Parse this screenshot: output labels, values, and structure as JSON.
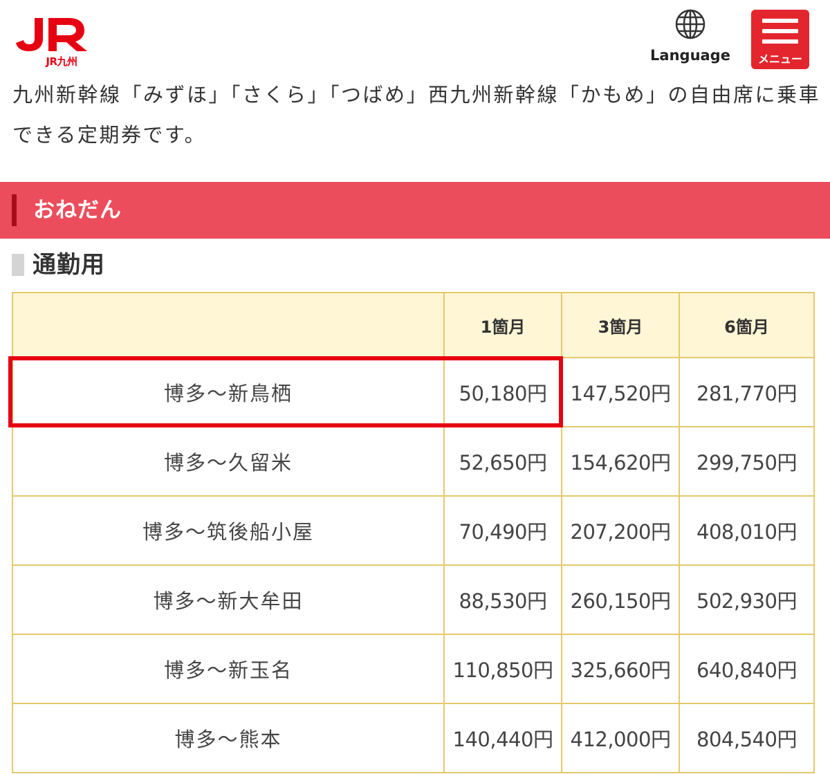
{
  "header": {
    "logo_text": "JR九州",
    "language_label": "Language",
    "language_icon": "globe-icon",
    "menu_label": "メニュー",
    "menu_icon": "hamburger-icon"
  },
  "intro_text": "九州新幹線「みずほ」「さくら」「つばめ」西九州新幹線「かもめ」の自由席に乗車できる定期券です。",
  "section": {
    "title": "おねだん"
  },
  "subsection": {
    "title": "通勤用"
  },
  "fare_table": {
    "headers": [
      "",
      "1箇月",
      "3箇月",
      "6箇月"
    ],
    "rows": [
      {
        "route": "博多～新鳥栖",
        "m1": "50,180円",
        "m3": "147,520円",
        "m6": "281,770円"
      },
      {
        "route": "博多～久留米",
        "m1": "52,650円",
        "m3": "154,620円",
        "m6": "299,750円"
      },
      {
        "route": "博多～筑後船小屋",
        "m1": "70,490円",
        "m3": "207,200円",
        "m6": "408,010円"
      },
      {
        "route": "博多～新大牟田",
        "m1": "88,530円",
        "m3": "260,150円",
        "m6": "502,930円"
      },
      {
        "route": "博多～新玉名",
        "m1": "110,850円",
        "m3": "325,660円",
        "m6": "640,840円"
      },
      {
        "route": "博多～熊本",
        "m1": "140,440円",
        "m3": "412,000円",
        "m6": "804,540円"
      }
    ]
  },
  "colors": {
    "brand_red": "#e60012",
    "section_bar": "#eb4d5c",
    "table_border": "#e5c96a",
    "table_header_bg": "#fff6d6"
  }
}
